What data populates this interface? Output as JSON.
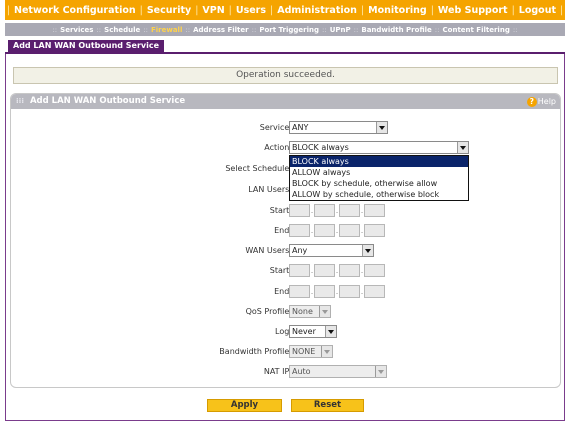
{
  "topnav": {
    "items": [
      "Network Configuration",
      "Security",
      "VPN",
      "Users",
      "Administration",
      "Monitoring",
      "Web Support",
      "Logout"
    ]
  },
  "subnav": {
    "items": [
      "Services",
      "Schedule",
      "Firewall",
      "Address Filter",
      "Port Triggering",
      "UPnP",
      "Bandwidth Profile",
      "Content Filtering"
    ],
    "active": "Firewall"
  },
  "page_tab": "Add LAN WAN Outbound Service",
  "status_message": "Operation succeeded.",
  "section": {
    "title": "Add LAN WAN Outbound Service",
    "help_label": "Help"
  },
  "form": {
    "service": {
      "label": "Service:",
      "value": "ANY"
    },
    "action": {
      "label": "Action:",
      "value": "BLOCK always"
    },
    "schedule": {
      "label": "Select Schedule:"
    },
    "lan_users": {
      "label": "LAN Users:"
    },
    "lan_start": {
      "label": "Start:"
    },
    "lan_end": {
      "label": "End:"
    },
    "wan_users": {
      "label": "WAN Users:",
      "value": "Any"
    },
    "wan_start": {
      "label": "Start:"
    },
    "wan_end": {
      "label": "End:"
    },
    "qos_profile": {
      "label": "QoS Profile:",
      "value": "None"
    },
    "log": {
      "label": "Log:",
      "value": "Never"
    },
    "bandwidth_profile": {
      "label": "Bandwidth Profile:",
      "value": "NONE"
    },
    "nat_ip": {
      "label": "NAT IP:",
      "value": "Auto"
    }
  },
  "action_dropdown": {
    "options": [
      "BLOCK always",
      "ALLOW always",
      "BLOCK by schedule, otherwise allow",
      "ALLOW by schedule, otherwise block"
    ],
    "highlighted_index": 0
  },
  "buttons": {
    "apply": "Apply",
    "reset": "Reset"
  },
  "colors": {
    "top_nav": "#f5a400",
    "sub_nav": "#a9a9b4",
    "tab": "#5a1e6e",
    "button": "#f7c21a",
    "highlight": "#0a246a"
  }
}
